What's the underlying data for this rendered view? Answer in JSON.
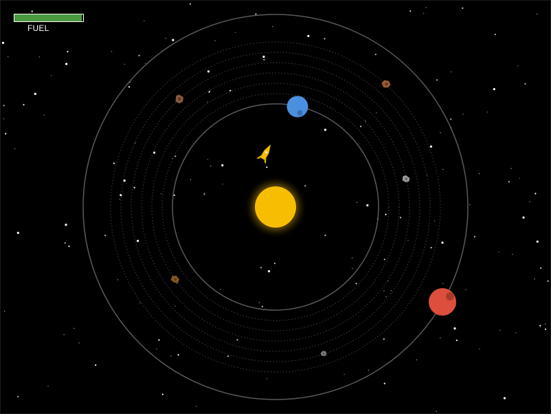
{
  "hud": {
    "fuel_label": "FUEL",
    "fuel_level": 0.98
  },
  "colors": {
    "background": "#000000",
    "orbit": "#5a5a5a",
    "belt": "#3a3a3a",
    "sun": "#f7bd00",
    "sun_glow": "#7a5c00",
    "planet_blue": "#4a8fe0",
    "planet_red": "#dd4f3c",
    "ship": "#f7bd00",
    "fuel": "#4a9a3f"
  },
  "icons": {
    "ship": "rocket-ship-icon",
    "sun": "sun-icon",
    "planet_blue": "blue-planet-icon",
    "planet_red": "red-planet-icon",
    "asteroid": "asteroid-icon"
  }
}
